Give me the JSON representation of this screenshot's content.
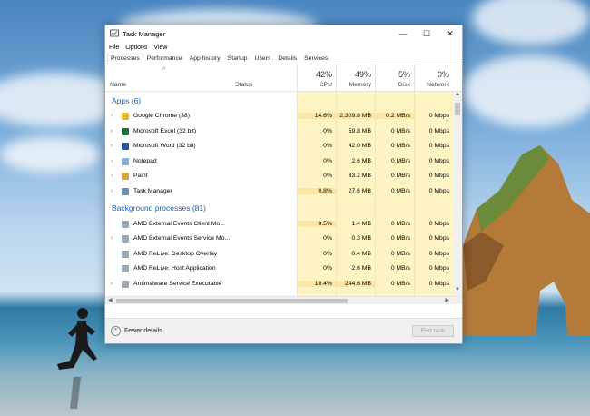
{
  "window": {
    "title": "Task Manager",
    "controls": {
      "minimize": "—",
      "maximize": "☐",
      "close": "✕"
    }
  },
  "menu": [
    "File",
    "Options",
    "View"
  ],
  "tabs": [
    "Processes",
    "Performance",
    "App history",
    "Startup",
    "Users",
    "Details",
    "Services"
  ],
  "active_tab": "Processes",
  "columns": {
    "name": "Name",
    "status": "Status",
    "cpu": {
      "percent": "42%",
      "label": "CPU"
    },
    "memory": {
      "percent": "49%",
      "label": "Memory"
    },
    "disk": {
      "percent": "5%",
      "label": "Disk"
    },
    "network": {
      "percent": "0%",
      "label": "Network"
    }
  },
  "groups": {
    "apps": "Apps (6)",
    "background": "Background processes (81)"
  },
  "apps": [
    {
      "name": "Google Chrome (38)",
      "cpu": "14.6%",
      "memory": "2,309.8 MB",
      "disk": "0.2 MB/s",
      "network": "0 Mbps",
      "icon": "chrome-icon",
      "color": "#e3b42b"
    },
    {
      "name": "Microsoft Excel (32 bit)",
      "cpu": "0%",
      "memory": "59.8 MB",
      "disk": "0 MB/s",
      "network": "0 Mbps",
      "icon": "excel-icon",
      "color": "#1e7145"
    },
    {
      "name": "Microsoft Word (32 bit)",
      "cpu": "0%",
      "memory": "42.0 MB",
      "disk": "0 MB/s",
      "network": "0 Mbps",
      "icon": "word-icon",
      "color": "#2b579a"
    },
    {
      "name": "Notepad",
      "cpu": "0%",
      "memory": "2.6 MB",
      "disk": "0 MB/s",
      "network": "0 Mbps",
      "icon": "notepad-icon",
      "color": "#7fb2d8"
    },
    {
      "name": "Paint",
      "cpu": "0%",
      "memory": "33.2 MB",
      "disk": "0 MB/s",
      "network": "0 Mbps",
      "icon": "paint-icon",
      "color": "#d9a441"
    },
    {
      "name": "Task Manager",
      "cpu": "0.8%",
      "memory": "27.6 MB",
      "disk": "0 MB/s",
      "network": "0 Mbps",
      "icon": "task-manager-icon",
      "color": "#6a8fb0"
    }
  ],
  "background": [
    {
      "name": "AMD External Events Client Mo...",
      "cpu": "0.5%",
      "memory": "1.4 MB",
      "disk": "0 MB/s",
      "network": "0 Mbps",
      "icon": "amd-icon",
      "color": "#9aa7b4"
    },
    {
      "name": "AMD External Events Service Mo...",
      "cpu": "0%",
      "memory": "0.3 MB",
      "disk": "0 MB/s",
      "network": "0 Mbps",
      "icon": "amd-icon",
      "color": "#9aa7b4"
    },
    {
      "name": "AMD ReLive: Desktop Overlay",
      "cpu": "0%",
      "memory": "0.4 MB",
      "disk": "0 MB/s",
      "network": "0 Mbps",
      "icon": "amd-icon",
      "color": "#9aa7b4"
    },
    {
      "name": "AMD ReLive: Host Application",
      "cpu": "0%",
      "memory": "2.6 MB",
      "disk": "0 MB/s",
      "network": "0 Mbps",
      "icon": "amd-icon",
      "color": "#9aa7b4"
    },
    {
      "name": "Antimalware Service Executable",
      "cpu": "10.4%",
      "memory": "244.6 MB",
      "disk": "0 MB/s",
      "network": "0 Mbps",
      "icon": "antimalware-icon",
      "color": "#9aa7b4"
    }
  ],
  "footer": {
    "fewer_details": "Fewer details",
    "end_task": "End task"
  }
}
